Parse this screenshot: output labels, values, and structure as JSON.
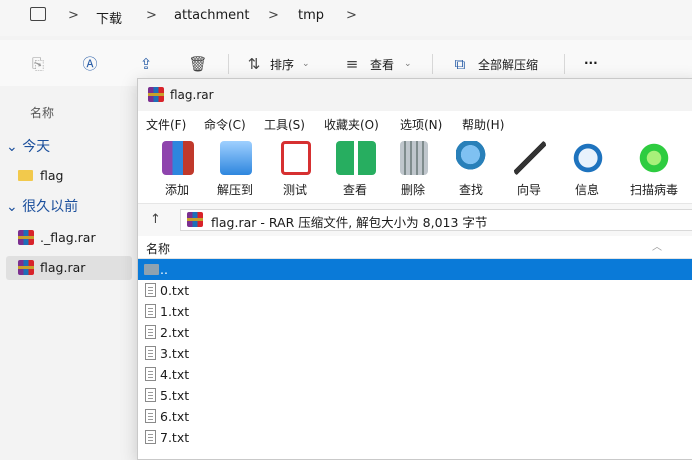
{
  "breadcrumb": {
    "items": [
      "下载",
      "attachment",
      "tmp"
    ],
    "separator": ">"
  },
  "explorer_toolbar": {
    "sort_label": "排序",
    "view_label": "查看",
    "extract_all_label": "全部解压缩",
    "more_label": "···"
  },
  "left_pane": {
    "column_header": "名称",
    "group_today": "今天",
    "today_items": [
      "flag"
    ],
    "group_earlier": "很久以前",
    "earlier_items": [
      "._flag.rar",
      "flag.rar"
    ]
  },
  "winrar": {
    "title": "flag.rar",
    "menu": [
      "文件(F)",
      "命令(C)",
      "工具(S)",
      "收藏夹(O)",
      "选项(N)",
      "帮助(H)"
    ],
    "tools": [
      {
        "label": "添加",
        "icon": "add-archive-icon",
        "color": "#c0392b"
      },
      {
        "label": "解压到",
        "icon": "extract-to-icon",
        "color": "#2e86de"
      },
      {
        "label": "测试",
        "icon": "test-icon",
        "color": "#d63031"
      },
      {
        "label": "查看",
        "icon": "view-book-icon",
        "color": "#27ae60"
      },
      {
        "label": "删除",
        "icon": "delete-trash-icon",
        "color": "#7f8c8d"
      },
      {
        "label": "查找",
        "icon": "find-magnifier-icon",
        "color": "#2980b9"
      },
      {
        "label": "向导",
        "icon": "wizard-wand-icon",
        "color": "#8e44ad"
      },
      {
        "label": "信息",
        "icon": "info-icon",
        "color": "#1e73be"
      },
      {
        "label": "扫描病毒",
        "icon": "virus-scan-icon",
        "color": "#2ecc40"
      }
    ],
    "path_text": "flag.rar - RAR 压缩文件, 解包大小为 8,013 字节",
    "column_name": "名称",
    "files": [
      "..",
      "0.txt",
      "1.txt",
      "2.txt",
      "3.txt",
      "4.txt",
      "5.txt",
      "6.txt",
      "7.txt"
    ],
    "selected_index": 0,
    "accent_color": "#0a7ad8"
  }
}
